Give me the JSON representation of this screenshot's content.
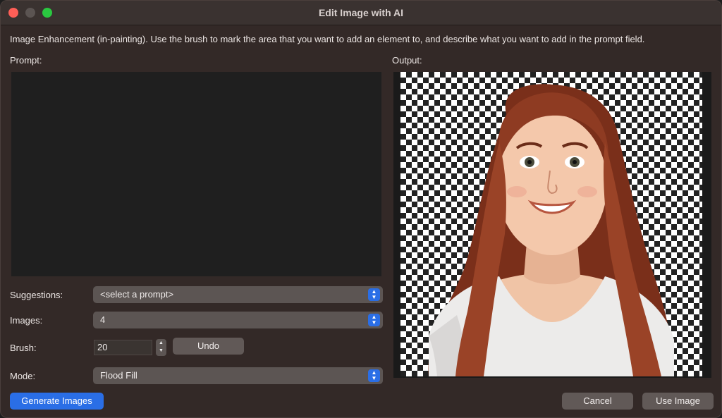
{
  "window": {
    "title": "Edit Image with AI"
  },
  "instructions": "Image Enhancement (in-painting). Use the brush to mark the area that you want to add an element to, and describe what you want to add in the prompt field.",
  "prompt": {
    "label": "Prompt:",
    "value": ""
  },
  "output": {
    "label": "Output:",
    "image_description": "3D cartoon woman with long auburn hair and white t-shirt on transparent checkerboard"
  },
  "suggestions": {
    "label": "Suggestions:",
    "value": "<select a prompt>"
  },
  "images": {
    "label": "Images:",
    "value": "4"
  },
  "brush": {
    "label": "Brush:",
    "value": "20",
    "undo_label": "Undo"
  },
  "mode": {
    "label": "Mode:",
    "value": "Flood Fill"
  },
  "buttons": {
    "generate": "Generate Images",
    "cancel": "Cancel",
    "use_image": "Use Image"
  },
  "colors": {
    "accent": "#2a6ee6",
    "window_bg": "#332927",
    "hair": "#8e3b22",
    "skin": "#f2c5a8",
    "shirt": "#ecebea"
  }
}
